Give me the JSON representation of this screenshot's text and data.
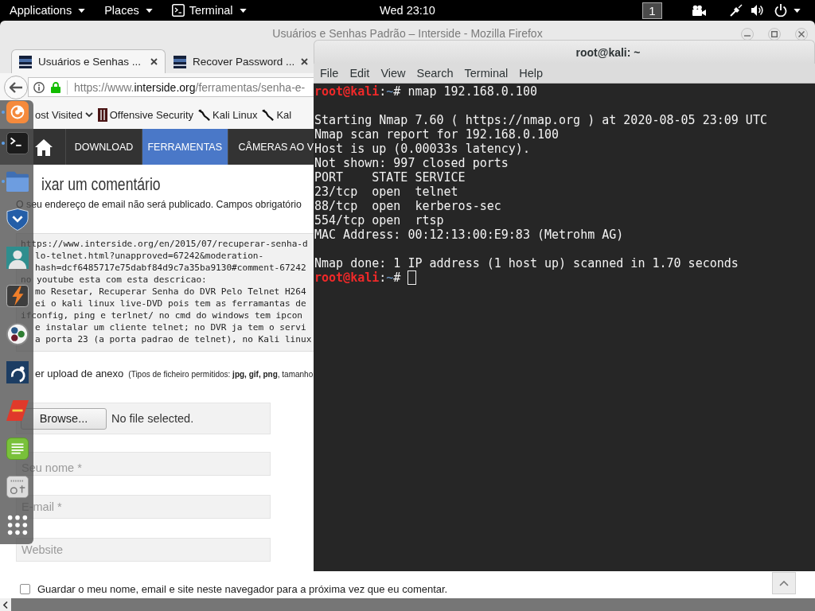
{
  "top_bar": {
    "menus": [
      {
        "label": "Applications",
        "kind": "menu"
      },
      {
        "label": "Places",
        "kind": "menu"
      },
      {
        "label": "Terminal",
        "kind": "app"
      }
    ],
    "clock": "Wed 23:10",
    "workspace": "1"
  },
  "dock": {
    "items": [
      {
        "kind": "browser",
        "running": true
      },
      {
        "kind": "terminal",
        "running": true
      },
      {
        "kind": "files",
        "running": true
      },
      {
        "kind": "shield",
        "running": false
      },
      {
        "kind": "avatar",
        "running": false
      },
      {
        "kind": "bolt",
        "running": false
      },
      {
        "kind": "circles",
        "running": false
      },
      {
        "kind": "tile",
        "running": false
      },
      {
        "kind": "logo",
        "running": false
      },
      {
        "kind": "editor",
        "running": false
      },
      {
        "kind": "device",
        "running": false
      },
      {
        "kind": "grid",
        "running": false
      }
    ]
  },
  "firefox": {
    "title": "Usuários e Senhas Padrão – Interside - Mozilla Firefox",
    "tabs": [
      {
        "label": "Usuários e Senhas ...",
        "selected": true
      },
      {
        "label": "Recover Password ...",
        "selected": false
      }
    ],
    "url": "https://www.**interside.org**/ferramentas/senha-e-",
    "bookmarks": [
      {
        "label": "ost Visited",
        "kind": "menu"
      },
      {
        "label": "Offensive Security",
        "kind": "tower"
      },
      {
        "label": "Kali Linux",
        "kind": "dragon"
      },
      {
        "label": "Kal",
        "kind": "dragon"
      }
    ],
    "site_nav": [
      {
        "label": "DOWNLOAD",
        "selected": false
      },
      {
        "label": "FERRAMENTAS",
        "selected": true
      },
      {
        "label": "CÂMERAS AO V",
        "selected": false
      }
    ],
    "comment_form": {
      "heading": "ixar um comentário",
      "notice": "O seu endereço de email não será publicado. Campos obrigatório",
      "comment_lines": [
        "https://www.interside.org/en/2015/07/recuperar-senha-d",
        "lo-telnet.html?unapproved=67242&moderation-",
        "hash=dcf6485717e75dabf84d9c7a35ba9130#comment-67242",
        "no youtube esta com esta descricao:",
        "mo Resetar, Recuperar Senha do DVR Pelo Telnet H264",
        "ei o kali linux live-DVD pois tem as ferramantas de",
        "ifconfig, ping e terlnet/ no cmd do windows tem ipcon",
        "e instalar um cliente telnet; no DVR ja tem o servi",
        "a porta 23 (a porta padrao de telnet), no Kali linux"
      ],
      "upload_label": "er upload de anexo",
      "upload_hint": "(Tipos de ficheiro permitidos: **jpg, gif, png**, tamanho",
      "browse_button": "Browse...",
      "file_status": "No file selected.",
      "fields": [
        {
          "placeholder": "Seu nome *"
        },
        {
          "placeholder": "E-mail *"
        },
        {
          "placeholder": "Website"
        }
      ],
      "save_info": {
        "label": "Guardar o meu nome, email e site neste navegador para a próxima vez que eu comentar.",
        "checked": false
      }
    }
  },
  "terminal": {
    "title": "root@kali: ~",
    "menu": [
      "File",
      "Edit",
      "View",
      "Search",
      "Terminal",
      "Help"
    ],
    "lines": [
      {
        "kind": "prompt",
        "host": "root@kali",
        "sep": ":",
        "path": "~",
        "symbol": "#",
        "command": "nmap 192.168.0.100",
        "cursor": false
      },
      {
        "kind": "blank"
      },
      {
        "kind": "output",
        "text": "Starting Nmap 7.60 ( https://nmap.org ) at 2020-08-05 23:09 UTC"
      },
      {
        "kind": "output",
        "text": "Nmap scan report for 192.168.0.100"
      },
      {
        "kind": "output",
        "text": "Host is up (0.00033s latency)."
      },
      {
        "kind": "output",
        "text": "Not shown: 997 closed ports"
      },
      {
        "kind": "output",
        "text": "PORT    STATE SERVICE"
      },
      {
        "kind": "output",
        "text": "23/tcp  open  telnet"
      },
      {
        "kind": "output",
        "text": "88/tcp  open  kerberos-sec"
      },
      {
        "kind": "output",
        "text": "554/tcp open  rtsp"
      },
      {
        "kind": "output",
        "text": "MAC Address: 00:12:13:00:E9:83 (Metrohm AG)"
      },
      {
        "kind": "blank"
      },
      {
        "kind": "output",
        "text": "Nmap done: 1 IP address (1 host up) scanned in 1.70 seconds"
      },
      {
        "kind": "prompt",
        "host": "root@kali",
        "sep": ":",
        "path": "~",
        "symbol": "#",
        "cursor": true
      }
    ]
  }
}
